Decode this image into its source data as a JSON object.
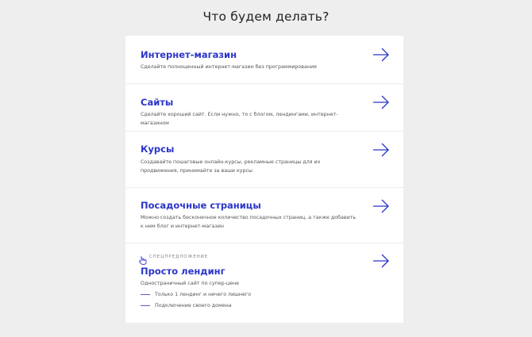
{
  "header": {
    "title": "Что будем делать?"
  },
  "options": [
    {
      "title": "Интернет-магазин",
      "desc": "Сделайте полноценный интернет-магазин без программирования"
    },
    {
      "title": "Сайты",
      "desc": "Сделайте хороший сайт. Если нужно, то с блогом, лендингами, интернет-магазином"
    },
    {
      "title": "Курсы",
      "desc": "Создавайте пошаговые онлайн-курсы, рекламные страницы для их продвижения, принимайте за ваши курсы"
    },
    {
      "title": "Посадочные страницы",
      "desc": "Можно создать бесконечное количество посадочных страниц, а также добавить к ним блог и интернет-магазин"
    }
  ],
  "special": {
    "badge": "СПЕЦПРЕДЛОЖЕНИЕ",
    "title": "Просто лендинг",
    "desc": "Одностраничный сайт по супер-цене",
    "features": [
      "Только 1 лендинг и ничего лишнего",
      "Подключение своего домена"
    ]
  },
  "colors": {
    "accent": "#2b35c9",
    "background": "#eeeeee",
    "card": "#ffffff"
  },
  "icons": {
    "arrow": "arrow-right-icon",
    "badge": "pointer-hand-icon"
  }
}
